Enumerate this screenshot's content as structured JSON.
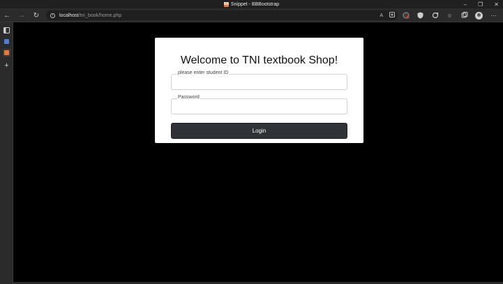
{
  "window": {
    "title": "Snippet - BBBootstrap",
    "favicon_text": "BB",
    "controls": {
      "minimize": "–",
      "restore": "❐",
      "close": "✕"
    }
  },
  "toolbar": {
    "back": "←",
    "forward": "→",
    "refresh": "↻",
    "url_host": "localhost",
    "url_path": "/tni_book/home.php",
    "read_aloud": "A",
    "favorite": "☆",
    "settings_menu": "⋯"
  },
  "sidebar": {
    "items": [
      {
        "name": "tabs-icon",
        "symbol": "▭"
      },
      {
        "name": "notes-icon",
        "symbol": ""
      },
      {
        "name": "bbbootstrap-tab",
        "symbol": ""
      },
      {
        "name": "add-icon",
        "symbol": "+"
      }
    ]
  },
  "page": {
    "heading": "Welcome to TNI textbook Shop!",
    "student_id_label": "please enter student ID",
    "student_id_value": "",
    "password_label": "Password",
    "password_value": "",
    "login_label": "Login"
  },
  "colors": {
    "background": "#000000",
    "card": "#ffffff",
    "button": "#2f3338",
    "favicon": "#e8793b",
    "sidebar_notes": "#4f7dd9"
  }
}
